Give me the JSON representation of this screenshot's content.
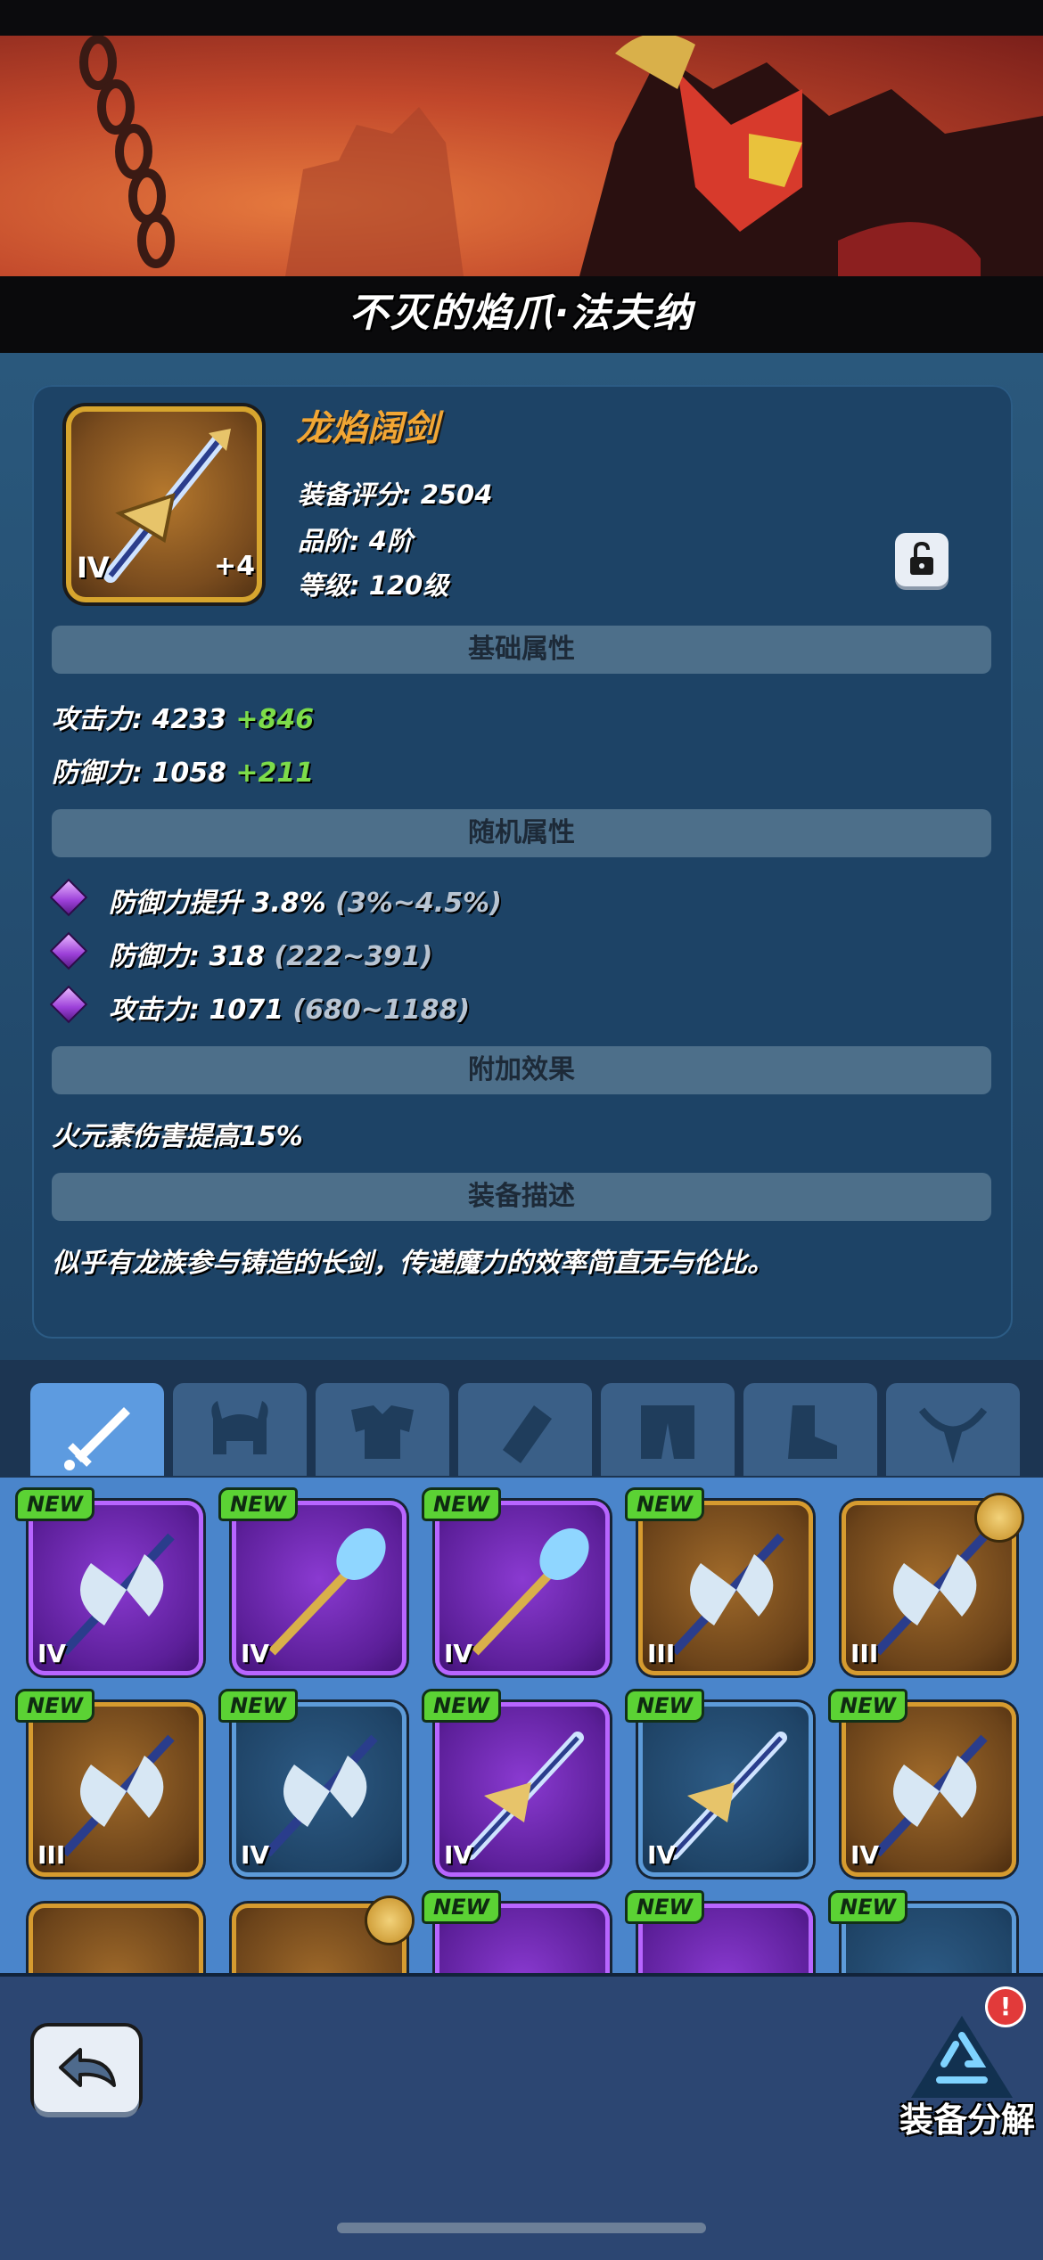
{
  "header": {
    "hero_title": "不灭的焰爪·法夫纳"
  },
  "item": {
    "name": "龙焰阔剑",
    "tier": "IV",
    "plus": "+4",
    "score": "装备评分: 2504",
    "grade": "品阶: 4阶",
    "level": "等级: 120级"
  },
  "sections": {
    "base": "基础属性",
    "random": "随机属性",
    "extra": "附加效果",
    "desc": "装备描述"
  },
  "base_stats": [
    {
      "label": "攻击力: 4233",
      "bonus": "+846"
    },
    {
      "label": "防御力: 1058",
      "bonus": "+211"
    }
  ],
  "random_stats": [
    {
      "label": "防御力提升 3.8%",
      "range": "(3%~4.5%)"
    },
    {
      "label": "防御力: 318",
      "range": "(222~391)"
    },
    {
      "label": "攻击力: 1071",
      "range": "(680~1188)"
    }
  ],
  "extra_effect": "火元素伤害提高15%",
  "description": "似乎有龙族参与铸造的长剑，传递魔力的效率简直无与伦比。",
  "tabs": [
    "sword-icon",
    "helmet-icon",
    "armor-icon",
    "bracer-icon",
    "pants-icon",
    "boots-icon",
    "necklace-icon"
  ],
  "inventory": {
    "new_tag": "NEW",
    "tiers": [
      "IV",
      "IV",
      "IV",
      "III",
      "III",
      "III",
      "IV",
      "IV",
      "IV",
      "IV"
    ]
  },
  "bottom": {
    "salvage_label": "装备分解",
    "alert": "!"
  }
}
